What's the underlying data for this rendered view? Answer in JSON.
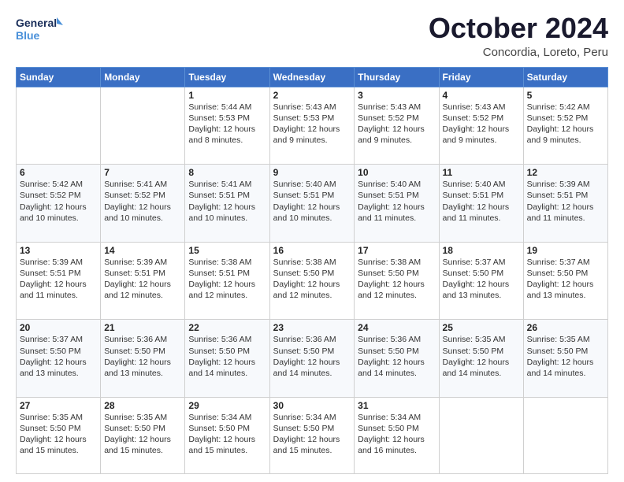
{
  "logo": {
    "line1": "General",
    "line2": "Blue"
  },
  "title": "October 2024",
  "subtitle": "Concordia, Loreto, Peru",
  "weekdays": [
    "Sunday",
    "Monday",
    "Tuesday",
    "Wednesday",
    "Thursday",
    "Friday",
    "Saturday"
  ],
  "weeks": [
    [
      {
        "day": "",
        "info": ""
      },
      {
        "day": "",
        "info": ""
      },
      {
        "day": "1",
        "info": "Sunrise: 5:44 AM\nSunset: 5:53 PM\nDaylight: 12 hours\nand 8 minutes."
      },
      {
        "day": "2",
        "info": "Sunrise: 5:43 AM\nSunset: 5:53 PM\nDaylight: 12 hours\nand 9 minutes."
      },
      {
        "day": "3",
        "info": "Sunrise: 5:43 AM\nSunset: 5:52 PM\nDaylight: 12 hours\nand 9 minutes."
      },
      {
        "day": "4",
        "info": "Sunrise: 5:43 AM\nSunset: 5:52 PM\nDaylight: 12 hours\nand 9 minutes."
      },
      {
        "day": "5",
        "info": "Sunrise: 5:42 AM\nSunset: 5:52 PM\nDaylight: 12 hours\nand 9 minutes."
      }
    ],
    [
      {
        "day": "6",
        "info": "Sunrise: 5:42 AM\nSunset: 5:52 PM\nDaylight: 12 hours\nand 10 minutes."
      },
      {
        "day": "7",
        "info": "Sunrise: 5:41 AM\nSunset: 5:52 PM\nDaylight: 12 hours\nand 10 minutes."
      },
      {
        "day": "8",
        "info": "Sunrise: 5:41 AM\nSunset: 5:51 PM\nDaylight: 12 hours\nand 10 minutes."
      },
      {
        "day": "9",
        "info": "Sunrise: 5:40 AM\nSunset: 5:51 PM\nDaylight: 12 hours\nand 10 minutes."
      },
      {
        "day": "10",
        "info": "Sunrise: 5:40 AM\nSunset: 5:51 PM\nDaylight: 12 hours\nand 11 minutes."
      },
      {
        "day": "11",
        "info": "Sunrise: 5:40 AM\nSunset: 5:51 PM\nDaylight: 12 hours\nand 11 minutes."
      },
      {
        "day": "12",
        "info": "Sunrise: 5:39 AM\nSunset: 5:51 PM\nDaylight: 12 hours\nand 11 minutes."
      }
    ],
    [
      {
        "day": "13",
        "info": "Sunrise: 5:39 AM\nSunset: 5:51 PM\nDaylight: 12 hours\nand 11 minutes."
      },
      {
        "day": "14",
        "info": "Sunrise: 5:39 AM\nSunset: 5:51 PM\nDaylight: 12 hours\nand 12 minutes."
      },
      {
        "day": "15",
        "info": "Sunrise: 5:38 AM\nSunset: 5:51 PM\nDaylight: 12 hours\nand 12 minutes."
      },
      {
        "day": "16",
        "info": "Sunrise: 5:38 AM\nSunset: 5:50 PM\nDaylight: 12 hours\nand 12 minutes."
      },
      {
        "day": "17",
        "info": "Sunrise: 5:38 AM\nSunset: 5:50 PM\nDaylight: 12 hours\nand 12 minutes."
      },
      {
        "day": "18",
        "info": "Sunrise: 5:37 AM\nSunset: 5:50 PM\nDaylight: 12 hours\nand 13 minutes."
      },
      {
        "day": "19",
        "info": "Sunrise: 5:37 AM\nSunset: 5:50 PM\nDaylight: 12 hours\nand 13 minutes."
      }
    ],
    [
      {
        "day": "20",
        "info": "Sunrise: 5:37 AM\nSunset: 5:50 PM\nDaylight: 12 hours\nand 13 minutes."
      },
      {
        "day": "21",
        "info": "Sunrise: 5:36 AM\nSunset: 5:50 PM\nDaylight: 12 hours\nand 13 minutes."
      },
      {
        "day": "22",
        "info": "Sunrise: 5:36 AM\nSunset: 5:50 PM\nDaylight: 12 hours\nand 14 minutes."
      },
      {
        "day": "23",
        "info": "Sunrise: 5:36 AM\nSunset: 5:50 PM\nDaylight: 12 hours\nand 14 minutes."
      },
      {
        "day": "24",
        "info": "Sunrise: 5:36 AM\nSunset: 5:50 PM\nDaylight: 12 hours\nand 14 minutes."
      },
      {
        "day": "25",
        "info": "Sunrise: 5:35 AM\nSunset: 5:50 PM\nDaylight: 12 hours\nand 14 minutes."
      },
      {
        "day": "26",
        "info": "Sunrise: 5:35 AM\nSunset: 5:50 PM\nDaylight: 12 hours\nand 14 minutes."
      }
    ],
    [
      {
        "day": "27",
        "info": "Sunrise: 5:35 AM\nSunset: 5:50 PM\nDaylight: 12 hours\nand 15 minutes."
      },
      {
        "day": "28",
        "info": "Sunrise: 5:35 AM\nSunset: 5:50 PM\nDaylight: 12 hours\nand 15 minutes."
      },
      {
        "day": "29",
        "info": "Sunrise: 5:34 AM\nSunset: 5:50 PM\nDaylight: 12 hours\nand 15 minutes."
      },
      {
        "day": "30",
        "info": "Sunrise: 5:34 AM\nSunset: 5:50 PM\nDaylight: 12 hours\nand 15 minutes."
      },
      {
        "day": "31",
        "info": "Sunrise: 5:34 AM\nSunset: 5:50 PM\nDaylight: 12 hours\nand 16 minutes."
      },
      {
        "day": "",
        "info": ""
      },
      {
        "day": "",
        "info": ""
      }
    ]
  ]
}
